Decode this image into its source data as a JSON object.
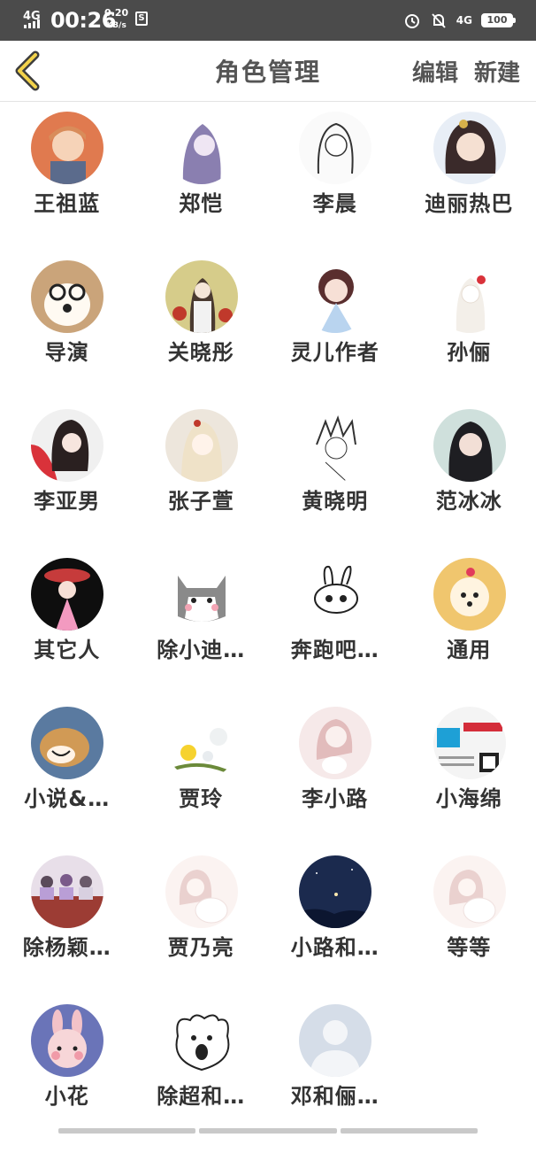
{
  "status_bar": {
    "network": "4G",
    "time": "00:26",
    "speed_value": "0.20",
    "speed_unit": "KB/s",
    "signal2": "4G",
    "battery": "100"
  },
  "header": {
    "title": "角色管理",
    "edit_label": "编辑",
    "create_label": "新建"
  },
  "roles": [
    {
      "name": "王祖蓝",
      "icon": "avatar-boy-anime"
    },
    {
      "name": "郑恺",
      "icon": "avatar-purple-hair"
    },
    {
      "name": "李晨",
      "icon": "avatar-sketch-girl"
    },
    {
      "name": "迪丽热巴",
      "icon": "avatar-anime-girl"
    },
    {
      "name": "导演",
      "icon": "avatar-dog-glasses"
    },
    {
      "name": "关晓彤",
      "icon": "avatar-girl-flowers"
    },
    {
      "name": "灵儿作者",
      "icon": "avatar-chibi-girl"
    },
    {
      "name": "孙俪",
      "icon": "avatar-white-girl"
    },
    {
      "name": "李亚男",
      "icon": "avatar-red-girl"
    },
    {
      "name": "张子萱",
      "icon": "avatar-blonde-girl"
    },
    {
      "name": "黄晓明",
      "icon": "avatar-sketch-boy"
    },
    {
      "name": "范冰冰",
      "icon": "avatar-woman-photo"
    },
    {
      "name": "其它人",
      "icon": "avatar-pink-doll"
    },
    {
      "name": "除小迪…",
      "icon": "avatar-cat-cartoon"
    },
    {
      "name": "奔跑吧…",
      "icon": "avatar-rabbit-doodle"
    },
    {
      "name": "通用",
      "icon": "avatar-poodle"
    },
    {
      "name": "小说&…",
      "icon": "avatar-shiba-dog"
    },
    {
      "name": "贾玲",
      "icon": "avatar-yellow-flower"
    },
    {
      "name": "李小路",
      "icon": "avatar-pastel-girl"
    },
    {
      "name": "小海绵",
      "icon": "avatar-poster"
    },
    {
      "name": "除杨颖…",
      "icon": "avatar-group-photo"
    },
    {
      "name": "贾乃亮",
      "icon": "avatar-pastel-couple"
    },
    {
      "name": "小路和…",
      "icon": "avatar-night-sky"
    },
    {
      "name": "等等",
      "icon": "avatar-pastel-couple-2"
    },
    {
      "name": "小花",
      "icon": "avatar-pink-bunny"
    },
    {
      "name": "除超和…",
      "icon": "avatar-white-dog-doodle"
    },
    {
      "name": "邓和俪…",
      "icon": "avatar-default-person"
    }
  ]
}
